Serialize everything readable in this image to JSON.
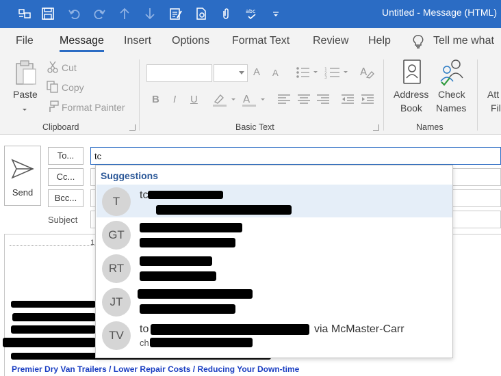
{
  "window": {
    "title": "Untitled  -  Message (HTML)"
  },
  "menu": {
    "items": [
      "File",
      "Message",
      "Insert",
      "Options",
      "Format Text",
      "Review",
      "Help"
    ],
    "active": "Message",
    "tell_me": "Tell me what"
  },
  "ribbon": {
    "clipboard": {
      "label": "Clipboard",
      "paste": "Paste",
      "cut": "Cut",
      "copy": "Copy",
      "format_painter": "Format Painter"
    },
    "basic_text": {
      "label": "Basic Text",
      "grow": "A",
      "shrink": "A",
      "bold": "B",
      "italic": "I",
      "underline": "U"
    },
    "names": {
      "label": "Names",
      "address_book_1": "Address",
      "address_book_2": "Book",
      "check_names_1": "Check",
      "check_names_2": "Names"
    },
    "attach": {
      "line1": "Att",
      "line2": "Fil"
    }
  },
  "compose": {
    "send": "Send",
    "to_button": "To...",
    "cc_button": "Cc...",
    "bcc_button": "Bcc...",
    "subject_label": "Subject",
    "to_value": "tc"
  },
  "ruler": {
    "mark": "1"
  },
  "suggestions": {
    "title": "Suggestions",
    "items": [
      {
        "initials": "T",
        "name": "tc",
        "email": ""
      },
      {
        "initials": "GT",
        "name": "",
        "email": ""
      },
      {
        "initials": "RT",
        "name": "",
        "email": ""
      },
      {
        "initials": "JT",
        "name": "",
        "email": ""
      },
      {
        "initials": "TV",
        "name": "to",
        "via": "via McMaster-Carr",
        "email": "ch"
      }
    ]
  },
  "body": {
    "link": "Premier Dry Van Trailers / Lower Repair Costs / Reducing Your Down-time"
  }
}
